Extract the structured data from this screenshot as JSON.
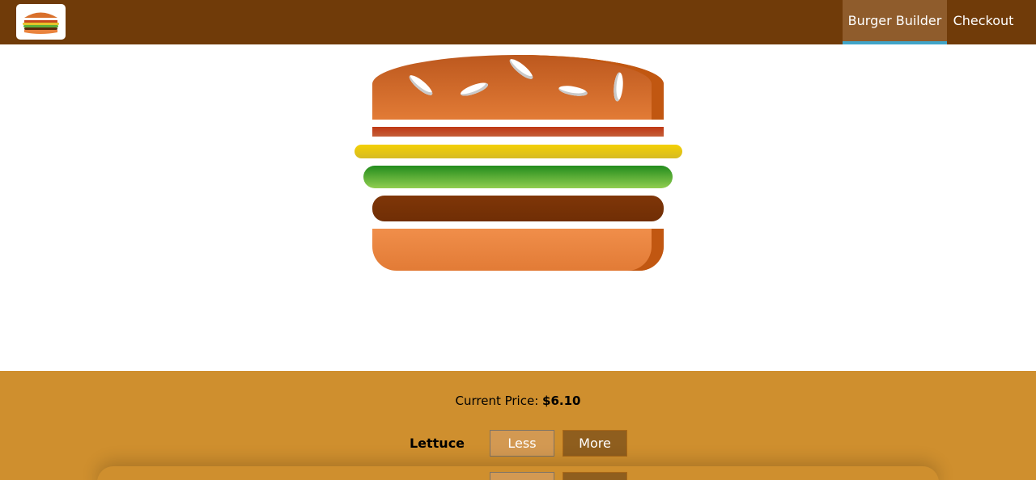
{
  "toolbar": {
    "logo_icon": "burger-logo-icon",
    "nav": [
      {
        "label": "Burger Builder",
        "active": true
      },
      {
        "label": "Checkout",
        "active": false
      }
    ],
    "colors": {
      "background": "#703b09",
      "active_item": "#8f5c2c",
      "active_underline": "#40a4c8"
    }
  },
  "burger": {
    "layers": [
      "bread-top",
      "bacon",
      "cheese",
      "salad",
      "meat",
      "bread-bottom"
    ]
  },
  "controls": {
    "price_label": "Current Price:",
    "price_value": "$6.10",
    "items": [
      {
        "label": "Lettuce",
        "less_label": "Less",
        "more_label": "More"
      },
      {
        "label": "",
        "less_label": "",
        "more_label": ""
      }
    ],
    "colors": {
      "background": "#cf8f2e",
      "less_button": "#d39952",
      "more_button": "#8f5e1e"
    }
  }
}
